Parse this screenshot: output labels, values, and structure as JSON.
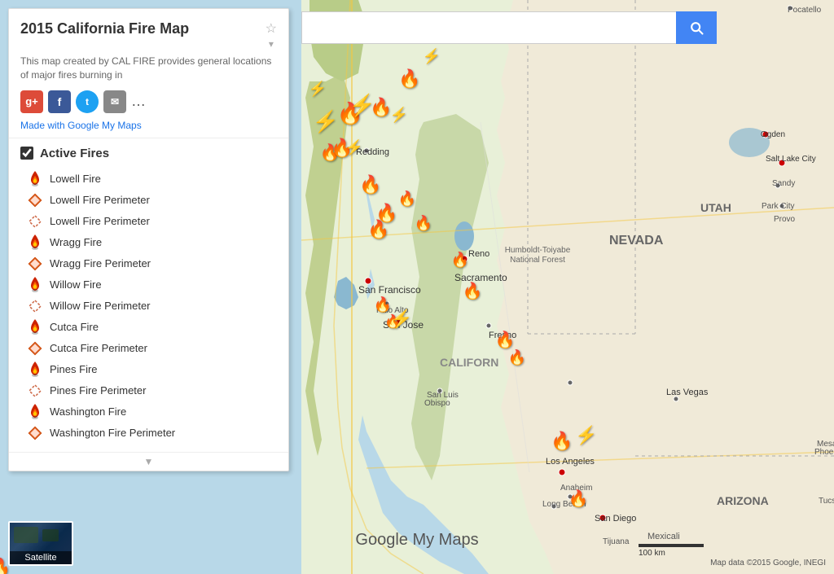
{
  "header": {
    "title": "2015 California Fire Map",
    "description": "This map created by CAL FIRE provides general locations of major fires burning in",
    "google_maps_link": "Made with Google My Maps",
    "search_placeholder": ""
  },
  "social": {
    "google_plus_color": "#dd4b39",
    "facebook_color": "#3b5998",
    "twitter_color": "#1da1f2"
  },
  "sidebar": {
    "active_fires_label": "Active Fires",
    "items": [
      {
        "name": "Lowell Fire",
        "icon": "🔥",
        "type": "fire"
      },
      {
        "name": "Lowell Fire Perimeter",
        "icon": "🔶",
        "type": "perimeter"
      },
      {
        "name": "Lowell Fire Perimeter",
        "icon": "🔷",
        "type": "perimeter2"
      },
      {
        "name": "Wragg Fire",
        "icon": "🔥",
        "type": "fire"
      },
      {
        "name": "Wragg Fire Perimeter",
        "icon": "🔶",
        "type": "perimeter"
      },
      {
        "name": "Willow Fire",
        "icon": "🔥",
        "type": "fire"
      },
      {
        "name": "Willow Fire Perimeter",
        "icon": "🔷",
        "type": "perimeter2"
      },
      {
        "name": "Cutca Fire",
        "icon": "🔥",
        "type": "fire"
      },
      {
        "name": "Cutca Fire Perimeter",
        "icon": "🔶",
        "type": "perimeter"
      },
      {
        "name": "Pines Fire",
        "icon": "🔥",
        "type": "fire"
      },
      {
        "name": "Pines Fire Perimeter",
        "icon": "🔷",
        "type": "perimeter2"
      },
      {
        "name": "Washington Fire",
        "icon": "🔥",
        "type": "fire"
      },
      {
        "name": "Washington Fire Perimeter",
        "icon": "🔶",
        "type": "perimeter"
      }
    ]
  },
  "satellite": {
    "label": "Satellite"
  },
  "branding": {
    "google_my_maps": "Google My Maps"
  },
  "attribution": {
    "text": "Map data ©2015 Google, INEGI"
  },
  "scale": {
    "label": "100 km"
  },
  "map_labels": {
    "nevada": "NEVADA",
    "utah": "UTAH",
    "arizona": "ARIZONA",
    "california": "CALIFORN",
    "reno": "Reno",
    "sacramento": "Sacramento",
    "san_francisco": "San Francisco",
    "palo_alto": "Palo Alto",
    "san_jose": "San Jose",
    "fresno": "Fresno",
    "los_angeles": "Los Angeles",
    "anaheim": "Anaheim",
    "long_beach": "Long Beach",
    "san_diego": "San Diego",
    "tijuana": "Tijuana",
    "mexicali": "Mexicali",
    "las_vegas": "Las Vegas",
    "salt_lake_city": "Salt Lake City",
    "ogden": "Ogden",
    "provo": "Provo",
    "pocatello": "Pocatello",
    "redding": "Redding",
    "san_luis_obispo": "San Luis\nObispo",
    "humboldt": "Humboldt-Toiyabe\nNational Forest",
    "phoenix": "Phoenix",
    "tucson": "Tucson"
  },
  "search": {
    "button_label": "🔍"
  }
}
